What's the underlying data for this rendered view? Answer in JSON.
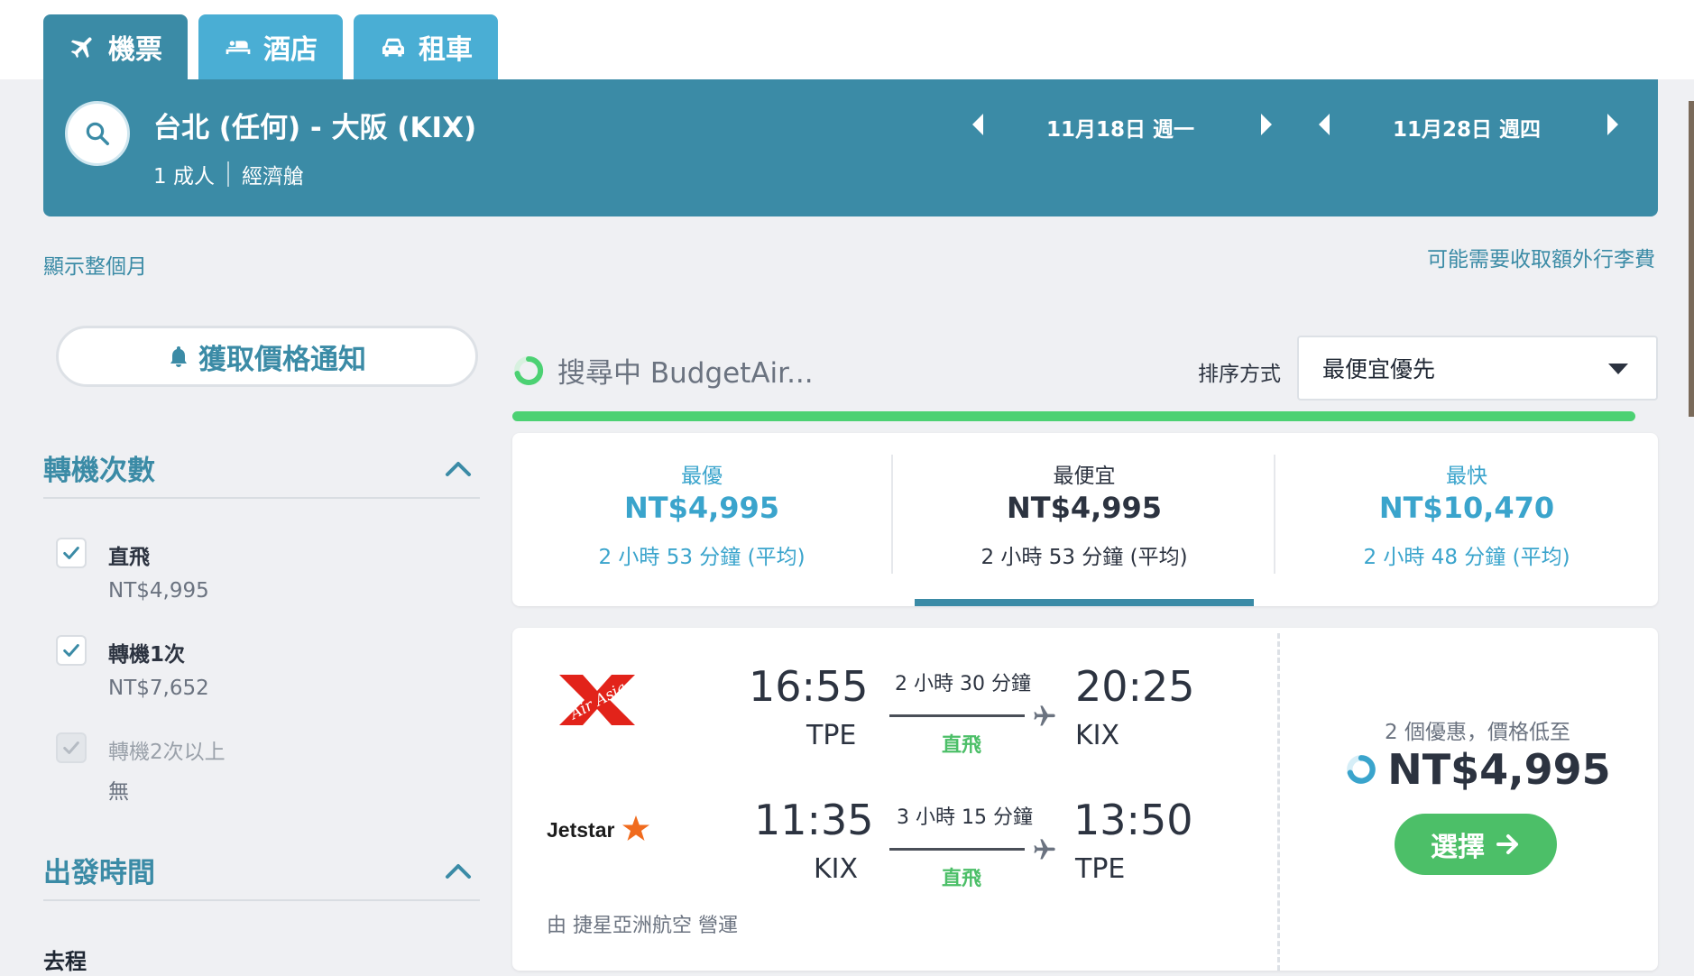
{
  "tabs": [
    {
      "label": "機票",
      "icon": "plane-icon"
    },
    {
      "label": "酒店",
      "icon": "bed-icon"
    },
    {
      "label": "租車",
      "icon": "car-icon"
    }
  ],
  "search": {
    "route": "台北 (任何) - 大阪 (KIX)",
    "passengers": "1 成人",
    "cabin": "經濟艙",
    "depart_date": "11月18日 週一",
    "return_date": "11月28日 週四"
  },
  "links": {
    "show_month": "顯示整個月",
    "extra_fees": "可能需要收取額外行李費"
  },
  "alert_button": "獲取價格通知",
  "filters": {
    "stops_title": "轉機次數",
    "stops": [
      {
        "label": "直飛",
        "price": "NT$4,995",
        "checked": true,
        "disabled": false
      },
      {
        "label": "轉機1次",
        "price": "NT$7,652",
        "checked": true,
        "disabled": false
      },
      {
        "label": "轉機2次以上",
        "price": "無",
        "checked": true,
        "disabled": true
      }
    ],
    "departure_title": "出發時間",
    "outbound_label": "去程"
  },
  "status": {
    "searching": "搜尋中 BudgetAir...",
    "progress_fraction": 0.98
  },
  "sort": {
    "label": "排序方式",
    "selected": "最便宜優先"
  },
  "summary": [
    {
      "label": "最優",
      "price": "NT$4,995",
      "duration": "2 小時 53 分鐘 (平均)",
      "active": false
    },
    {
      "label": "最便宜",
      "price": "NT$4,995",
      "duration": "2 小時 53 分鐘 (平均)",
      "active": true
    },
    {
      "label": "最快",
      "price": "NT$10,470",
      "duration": "2 小時 48 分鐘 (平均)",
      "active": false
    }
  ],
  "result": {
    "legs": [
      {
        "airline": "AirAsia",
        "dep_time": "16:55",
        "dep_airport": "TPE",
        "duration": "2 小時 30 分鐘",
        "stops": "直飛",
        "arr_time": "20:25",
        "arr_airport": "KIX"
      },
      {
        "airline": "Jetstar",
        "dep_time": "11:35",
        "dep_airport": "KIX",
        "duration": "3 小時 15 分鐘",
        "stops": "直飛",
        "arr_time": "13:50",
        "arr_airport": "TPE"
      }
    ],
    "operated_by": "由 捷星亞洲航空 營運",
    "deals_text": "2 個優惠，價格低至",
    "price": "NT$4,995",
    "select_label": "選擇"
  },
  "colors": {
    "brand": "#3b8ba6",
    "tab_inactive": "#4aaed4",
    "accent_green": "#4cbf68",
    "progress": "#4cd173"
  }
}
